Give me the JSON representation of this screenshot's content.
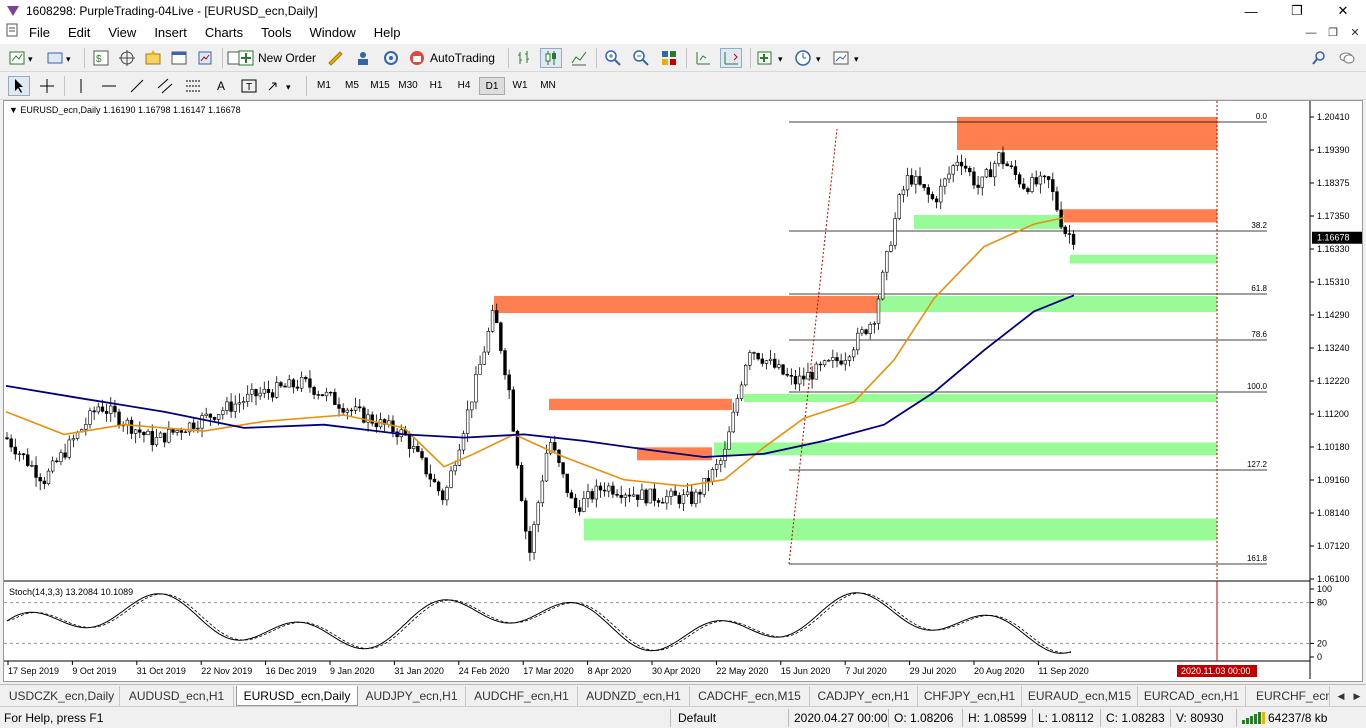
{
  "window": {
    "title": "1608298: PurpleTrading-04Live - [EURUSD_ecn,Daily]",
    "minimize_icon": "minimize-icon",
    "maximize_icon": "restore-icon",
    "close_icon": "close-icon"
  },
  "menu": {
    "items": [
      "File",
      "Edit",
      "View",
      "Insert",
      "Charts",
      "Tools",
      "Window",
      "Help"
    ]
  },
  "toolbar": {
    "new_order_label": "New Order",
    "autotrading_label": "AutoTrading"
  },
  "timeframes": [
    "M1",
    "M5",
    "M15",
    "M30",
    "H1",
    "H4",
    "D1",
    "W1",
    "MN"
  ],
  "active_timeframe": "D1",
  "chart": {
    "header": "EURUSD_ecn,Daily  1.16190 1.16798 1.16147 1.16678",
    "current_price": "1.16678",
    "price_axis": [
      "1.20410",
      "1.19390",
      "1.18375",
      "1.17350",
      "1.16330",
      "1.15310",
      "1.14290",
      "1.13240",
      "1.12220",
      "1.11200",
      "1.10180",
      "1.09160",
      "1.08140",
      "1.07120",
      "1.06100"
    ],
    "fib_levels": [
      "0.0",
      "38.2",
      "61.8",
      "78.6",
      "100.0",
      "127.2",
      "161.8"
    ],
    "date_axis": [
      "17 Sep 2019",
      "9 Oct 2019",
      "31 Oct 2019",
      "22 Nov 2019",
      "16 Dec 2019",
      "9 Jan 2020",
      "31 Jan 2020",
      "24 Feb 2020",
      "17 Mar 2020",
      "8 Apr 2020",
      "30 Apr 2020",
      "22 May 2020",
      "15 Jun 2020",
      "7 Jul 2020",
      "29 Jul 2020",
      "20 Aug 2020",
      "11 Sep 2020"
    ],
    "future_date_label": "2020.11.03 00:00",
    "indicator_header": "Stoch(14,3,3) 13.2084 10.1089",
    "indicator_axis": [
      "100",
      "80",
      "20",
      "0"
    ],
    "colors": {
      "supply_zone": "#ff7f50",
      "demand_zone": "#98fb98",
      "ma_fast": "#e8900a",
      "ma_slow": "#000080",
      "candles": "#000000",
      "vline": "#c00000"
    }
  },
  "tabs": [
    "USDCZK_ecn,Daily",
    "AUDUSD_ecn,H1",
    "EURUSD_ecn,Daily",
    "AUDJPY_ecn,H1",
    "AUDCHF_ecn,H1",
    "AUDNZD_ecn,H1",
    "CADCHF_ecn,M15",
    "CADJPY_ecn,H1",
    "CHFJPY_ecn,H1",
    "EURAUD_ecn,M15",
    "EURCAD_ecn,H1",
    "EURCHF_ecn,"
  ],
  "active_tab": "EURUSD_ecn,Daily",
  "status": {
    "help": "For Help, press F1",
    "profile": "Default",
    "datetime": "2020.04.27 00:00",
    "open": "O: 1.08206",
    "high": "H: 1.08599",
    "low": "L: 1.08112",
    "close": "C: 1.08283",
    "volume": "V: 80930",
    "traffic": "64237/8 kb"
  }
}
